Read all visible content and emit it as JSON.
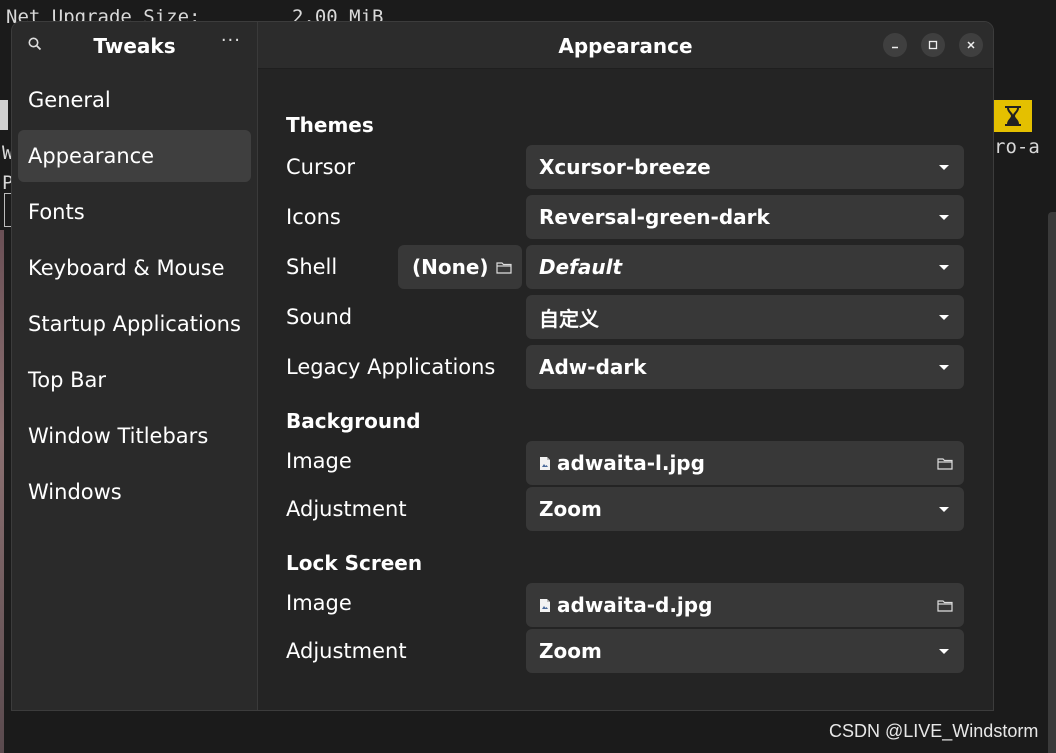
{
  "background": {
    "terminal_top_line": "Net Upgrade Size:        2.00 MiB",
    "terminal_fragment": "ro-a",
    "terminal_chars": [
      "W",
      "P"
    ],
    "watermark": "CSDN @LIVE_Windstorm"
  },
  "sidebar": {
    "title": "Tweaks",
    "menu_glyph": "···",
    "items": [
      {
        "label": "General"
      },
      {
        "label": "Appearance",
        "active": true
      },
      {
        "label": "Fonts"
      },
      {
        "label": "Keyboard & Mouse"
      },
      {
        "label": "Startup Applications"
      },
      {
        "label": "Top Bar"
      },
      {
        "label": "Window Titlebars"
      },
      {
        "label": "Windows"
      }
    ]
  },
  "header": {
    "title": "Appearance"
  },
  "themes": {
    "title": "Themes",
    "cursor": {
      "label": "Cursor",
      "value": "Xcursor-breeze"
    },
    "icons": {
      "label": "Icons",
      "value": "Reversal-green-dark"
    },
    "shell": {
      "label": "Shell",
      "file_value": "(None)",
      "value": "Default"
    },
    "sound": {
      "label": "Sound",
      "value": "自定义"
    },
    "legacy": {
      "label": "Legacy Applications",
      "value": "Adw-dark"
    }
  },
  "background_section": {
    "title": "Background",
    "image": {
      "label": "Image",
      "value": "adwaita-l.jpg"
    },
    "adjustment": {
      "label": "Adjustment",
      "value": "Zoom"
    }
  },
  "lock_screen": {
    "title": "Lock Screen",
    "image": {
      "label": "Image",
      "value": "adwaita-d.jpg"
    },
    "adjustment": {
      "label": "Adjustment",
      "value": "Zoom"
    }
  },
  "colors": {
    "window_bg": "#242424",
    "sidebar_bg": "#2a2a2a",
    "active_item": "#3f3f3f",
    "combo_bg": "#383838",
    "hourglass_bg": "#e4c000"
  }
}
